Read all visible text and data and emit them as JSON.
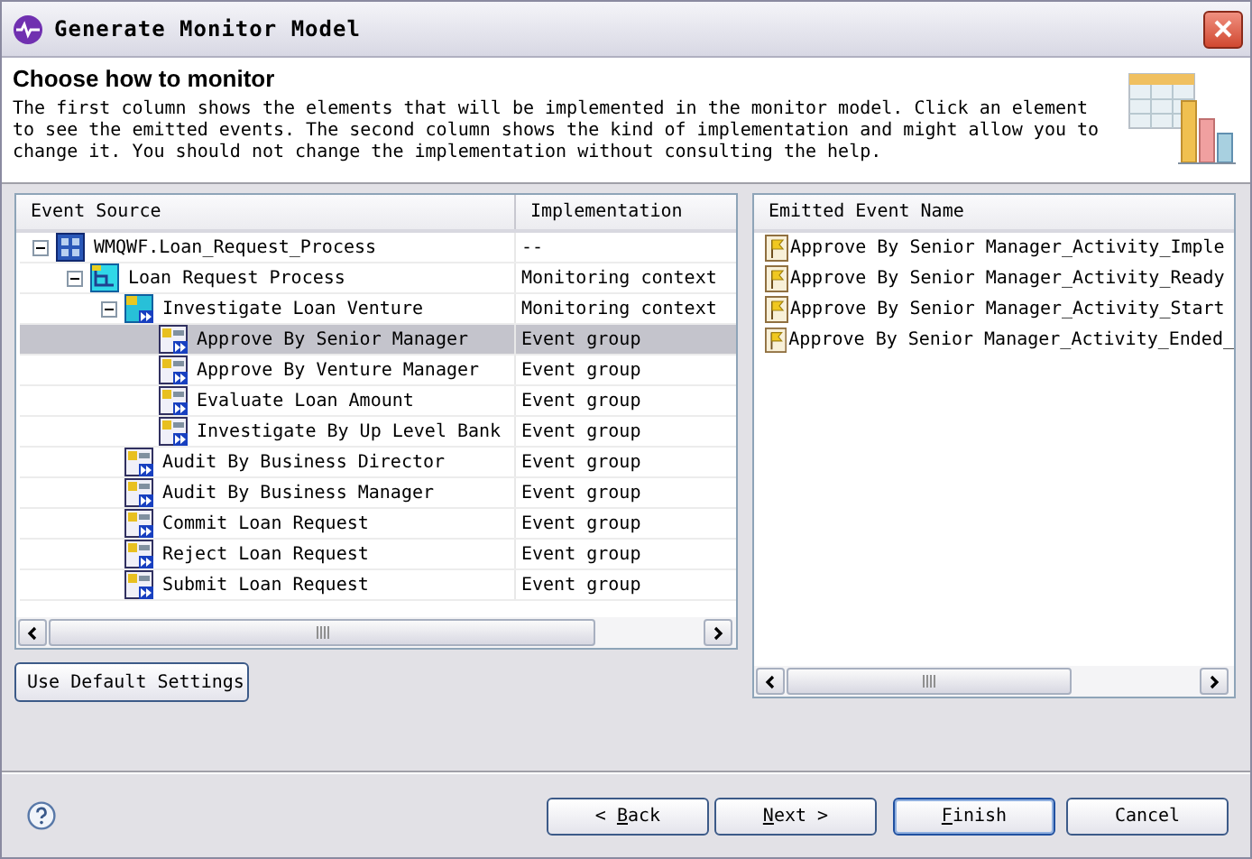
{
  "window": {
    "title": "Generate Monitor Model"
  },
  "header": {
    "title": "Choose how to monitor",
    "description": "The first column shows the elements that will be implemented in the monitor model.  Click an element to see the emitted events. The second column shows the kind of implementation and might allow you to change it. You should not change the implementation without consulting the help."
  },
  "tree": {
    "columns": [
      "Event Source",
      "Implementation"
    ],
    "items": [
      {
        "label": "WMQWF.Loan_Request_Process",
        "implementation": "--",
        "kind": "module",
        "selected": false,
        "expanded": true,
        "children": [
          {
            "label": "Loan Request Process",
            "implementation": "Monitoring context",
            "kind": "process",
            "selected": false,
            "expanded": true,
            "children": [
              {
                "label": "Investigate Loan Venture",
                "implementation": "Monitoring context",
                "kind": "subprocess",
                "selected": false,
                "expanded": true,
                "children": [
                  {
                    "label": "Approve By Senior Manager",
                    "implementation": "Event group",
                    "kind": "activity",
                    "selected": true
                  },
                  {
                    "label": "Approve By Venture Manager",
                    "implementation": "Event group",
                    "kind": "activity",
                    "selected": false
                  },
                  {
                    "label": "Evaluate Loan Amount",
                    "implementation": "Event group",
                    "kind": "activity",
                    "selected": false
                  },
                  {
                    "label": "Investigate By Up Level Bank",
                    "implementation": "Event group",
                    "kind": "activity",
                    "selected": false
                  }
                ]
              },
              {
                "label": "Audit By Business Director",
                "implementation": "Event group",
                "kind": "activity",
                "selected": false
              },
              {
                "label": "Audit By Business Manager",
                "implementation": "Event group",
                "kind": "activity",
                "selected": false
              },
              {
                "label": "Commit Loan Request",
                "implementation": "Event group",
                "kind": "activity",
                "selected": false
              },
              {
                "label": "Reject Loan Request",
                "implementation": "Event group",
                "kind": "activity",
                "selected": false
              },
              {
                "label": "Submit Loan Request",
                "implementation": "Event group",
                "kind": "activity",
                "selected": false
              }
            ]
          }
        ]
      }
    ]
  },
  "use_default_button": "Use Default Settings",
  "events": {
    "column": "Emitted Event Name",
    "items": [
      "Approve By Senior Manager_Activity_Imple",
      "Approve By Senior Manager_Activity_Ready",
      "Approve By Senior Manager_Activity_Start",
      "Approve By Senior Manager_Activity_Ended_"
    ]
  },
  "buttons": [
    {
      "before": "< ",
      "key": "B",
      "after": "ack",
      "default": false
    },
    {
      "key": "N",
      "after": "ext >",
      "default": false
    },
    {
      "key": "F",
      "after": "inish",
      "default": true
    },
    {
      "after": "Cancel",
      "default": false
    }
  ]
}
